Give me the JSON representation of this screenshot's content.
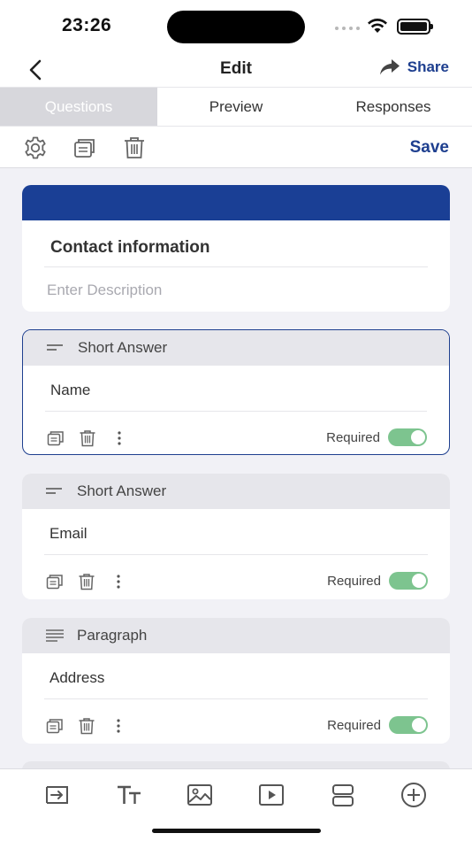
{
  "status": {
    "time": "23:26"
  },
  "nav": {
    "title": "Edit",
    "share_label": "Share"
  },
  "tabs": [
    {
      "label": "Questions",
      "active": true
    },
    {
      "label": "Preview",
      "active": false
    },
    {
      "label": "Responses",
      "active": false
    }
  ],
  "toolbar": {
    "save_label": "Save"
  },
  "form": {
    "title": "Contact information",
    "description_placeholder": "Enter Description",
    "accent_color": "#1a3f95"
  },
  "questions": [
    {
      "type": "Short Answer",
      "label": "Name",
      "required_label": "Required",
      "required": true,
      "selected": true
    },
    {
      "type": "Short Answer",
      "label": "Email",
      "required_label": "Required",
      "required": true,
      "selected": false
    },
    {
      "type": "Paragraph",
      "label": "Address",
      "required_label": "Required",
      "required": true,
      "selected": false
    }
  ],
  "colors": {
    "brand": "#1e3f8f",
    "toggle_on": "#7dc48f"
  }
}
